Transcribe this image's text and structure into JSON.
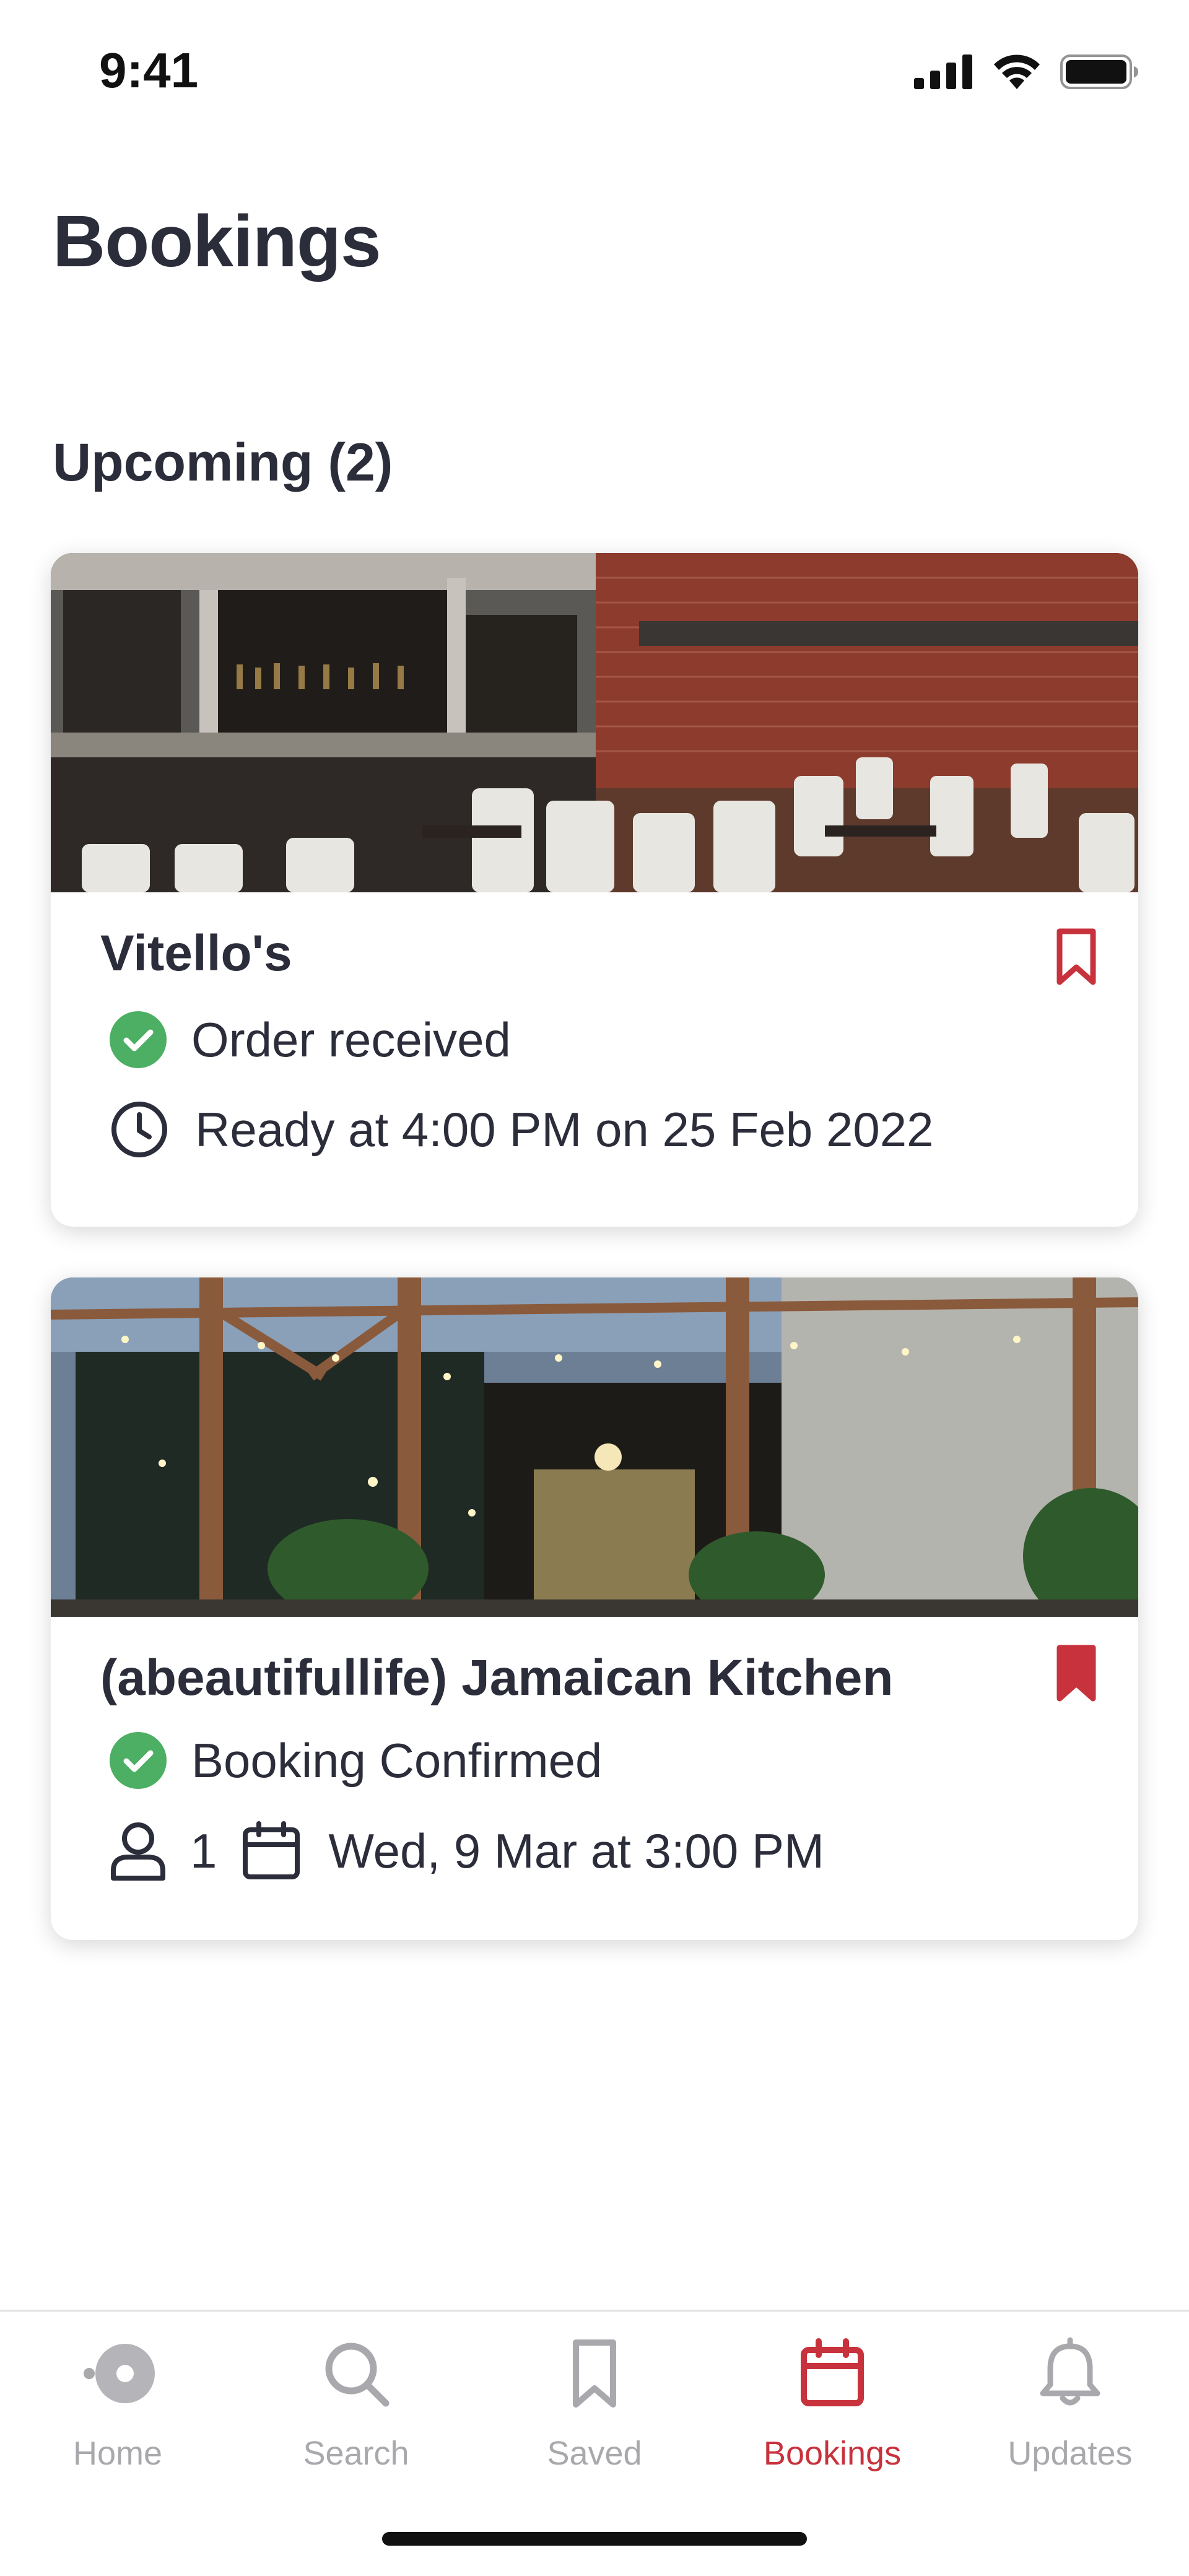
{
  "status_bar": {
    "time": "9:41"
  },
  "header": {
    "title": "Bookings"
  },
  "upcoming": {
    "title": "Upcoming (2)",
    "bookings": [
      {
        "name": "Vitello's",
        "status": "Order received",
        "detail": "Ready at 4:00 PM on 25 Feb 2022",
        "bookmark_saved": false
      },
      {
        "name": "(abeautifullife) Jamaican Kitchen",
        "status": "Booking Confirmed",
        "party_size": "1",
        "datetime": "Wed, 9 Mar at 3:00 PM",
        "bookmark_saved": true
      }
    ]
  },
  "tab_bar": {
    "tabs": [
      {
        "label": "Home",
        "icon": "home-dot-icon"
      },
      {
        "label": "Search",
        "icon": "search-icon"
      },
      {
        "label": "Saved",
        "icon": "bookmark-icon"
      },
      {
        "label": "Bookings",
        "icon": "calendar-icon",
        "active": true
      },
      {
        "label": "Updates",
        "icon": "bell-icon"
      }
    ]
  },
  "colors": {
    "accent": "#c8323c",
    "success": "#4caf63",
    "text": "#2b2d3a",
    "inactive": "#a9a9ad"
  }
}
